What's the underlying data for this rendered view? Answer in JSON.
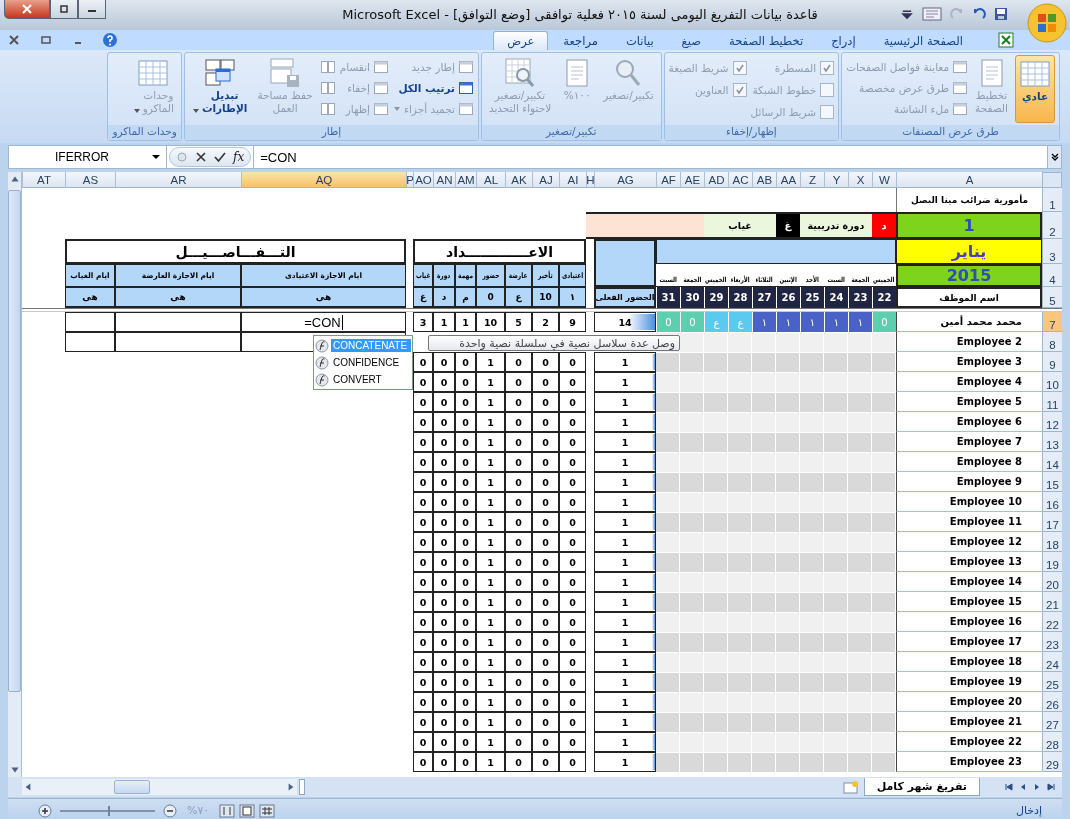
{
  "window": {
    "title": "قاعدة بيانات التفريغ اليومى لسنة ٢٠١٥ فعلية توافقى  [وضع التوافق] - Microsoft Excel"
  },
  "tabs": [
    {
      "label": "الصفحة الرئيسية",
      "selected": false
    },
    {
      "label": "إدراج",
      "selected": false
    },
    {
      "label": "تخطيط الصفحة",
      "selected": false
    },
    {
      "label": "صيغ",
      "selected": false
    },
    {
      "label": "بيانات",
      "selected": false
    },
    {
      "label": "مراجعة",
      "selected": false
    },
    {
      "label": "عرض",
      "selected": true
    }
  ],
  "ribbon": {
    "groups": [
      {
        "label": "طرق عرض المصنفات",
        "columns": [
          [
            {
              "kind": "large",
              "label": "عادي",
              "selected": true,
              "disabled": false
            }
          ],
          [
            {
              "kind": "large",
              "label": "تخطيط\nالصفحة",
              "selected": false,
              "disabled": true
            }
          ],
          [
            {
              "kind": "small",
              "label": "معاينة فواصل الصفحات",
              "disabled": true
            },
            {
              "kind": "small",
              "label": "طرق عرض مخصصة",
              "disabled": true
            },
            {
              "kind": "small",
              "label": "ملء الشاشة",
              "disabled": true
            }
          ]
        ]
      },
      {
        "label": "إظهار/إخفاء",
        "columns": [
          [
            {
              "kind": "check",
              "label": "المسطرة",
              "checked": true,
              "disabled": true
            },
            {
              "kind": "check",
              "label": "خطوط الشبكة",
              "checked": false,
              "disabled": true
            },
            {
              "kind": "check",
              "label": "شريط الرسائل",
              "checked": false,
              "disabled": true
            }
          ],
          [
            {
              "kind": "check",
              "label": "شريط الصيغة",
              "checked": true,
              "disabled": true
            },
            {
              "kind": "check",
              "label": "العناوين",
              "checked": true,
              "disabled": true
            }
          ]
        ]
      },
      {
        "label": "تكبير/تصغير",
        "columns": [
          [
            {
              "kind": "large",
              "label": "تكبير/تصغير",
              "selected": false,
              "disabled": true
            }
          ],
          [
            {
              "kind": "large",
              "label": "١٠٠%",
              "selected": false,
              "disabled": true
            }
          ],
          [
            {
              "kind": "large",
              "label": "تكبير/تصغير\nلاحتواء التحديد",
              "selected": false,
              "disabled": true
            }
          ]
        ]
      },
      {
        "label": "إطار",
        "columns": [
          [
            {
              "kind": "small",
              "label": "إطار جديد",
              "disabled": true
            },
            {
              "kind": "small",
              "label": "ترتيب الكل",
              "disabled": false
            },
            {
              "kind": "small",
              "label": "تجميد أجزاء",
              "disabled": true,
              "caret": true
            }
          ],
          [
            {
              "kind": "small",
              "label": "انقسام",
              "disabled": true
            },
            {
              "kind": "small",
              "label": "إخفاء",
              "disabled": true
            },
            {
              "kind": "small",
              "label": "إظهار",
              "disabled": true
            }
          ],
          [
            {
              "kind": "icon",
              "disabled": true
            },
            {
              "kind": "icon",
              "disabled": true
            },
            {
              "kind": "icon",
              "disabled": true
            }
          ],
          [
            {
              "kind": "large",
              "label": "حفظ مساحة\nالعمل",
              "selected": false,
              "disabled": true
            }
          ],
          [
            {
              "kind": "large",
              "label": "تبديل\nالإطارات",
              "selected": false,
              "disabled": false,
              "caret": true
            }
          ]
        ]
      },
      {
        "label": "وحدات الماكرو",
        "columns": [
          [
            {
              "kind": "large",
              "label": "وحدات\nالماكرو",
              "selected": false,
              "disabled": true,
              "caret": true
            }
          ]
        ]
      }
    ]
  },
  "formula_bar": {
    "name_box": "IFERROR",
    "insert_function": "fx",
    "formula": "=CON"
  },
  "sheet": {
    "columns": [
      {
        "label": "A",
        "selected": false
      },
      {
        "label": "W",
        "selected": false
      },
      {
        "label": "X",
        "selected": false
      },
      {
        "label": "Y",
        "selected": false
      },
      {
        "label": "Z",
        "selected": false
      },
      {
        "label": "AA",
        "selected": false
      },
      {
        "label": "AB",
        "selected": false
      },
      {
        "label": "AC",
        "selected": false
      },
      {
        "label": "AD",
        "selected": false
      },
      {
        "label": "AE",
        "selected": false
      },
      {
        "label": "AF",
        "selected": false
      },
      {
        "label": "AG",
        "selected": false
      },
      {
        "label": "H",
        "selected": false
      },
      {
        "label": "AI",
        "selected": false
      },
      {
        "label": "AJ",
        "selected": false
      },
      {
        "label": "AK",
        "selected": false
      },
      {
        "label": "AL",
        "selected": false
      },
      {
        "label": "AM",
        "selected": false
      },
      {
        "label": "AN",
        "selected": false
      },
      {
        "label": "AO",
        "selected": false
      },
      {
        "label": "P",
        "selected": false
      },
      {
        "label": "AQ",
        "selected": true
      },
      {
        "label": "AR",
        "selected": false
      },
      {
        "label": "AS",
        "selected": false
      },
      {
        "label": "AT",
        "selected": false
      }
    ],
    "top_rows": [
      {
        "num": "1",
        "selected": false
      },
      {
        "num": "2",
        "selected": false
      },
      {
        "num": "3",
        "selected": false
      },
      {
        "num": "4",
        "selected": false
      },
      {
        "num": "5",
        "selected": false
      }
    ],
    "office": "مأمورية ضرائب مينا البصل",
    "number": "1",
    "month": "يناير",
    "year": "2015",
    "name_heading": "اسم الموظف",
    "legend": [
      {
        "code": "د",
        "label": "دورة تدريبية",
        "color": "#ff0000"
      },
      {
        "code": "غ",
        "label": "غياب",
        "color": "#000000"
      }
    ],
    "days": [
      {
        "name": "الخميس",
        "date": "22"
      },
      {
        "name": "الجمعة",
        "date": "23"
      },
      {
        "name": "السبت",
        "date": "24"
      },
      {
        "name": "الأحد",
        "date": "25"
      },
      {
        "name": "الإثنين",
        "date": "26"
      },
      {
        "name": "الثلاثاء",
        "date": "27"
      },
      {
        "name": "الأربعاء",
        "date": "28"
      },
      {
        "name": "الخميس",
        "date": "29"
      },
      {
        "name": "الجمعة",
        "date": "30"
      },
      {
        "name": "السبت",
        "date": "31"
      }
    ],
    "attendance_heading": "الحضور الفعلى",
    "counts": {
      "title": "الاعـــــــــــــداد",
      "columns": [
        {
          "heading": "اعتيادى",
          "code": "١"
        },
        {
          "heading": "تأخير",
          "code": "10"
        },
        {
          "heading": "عارضة",
          "code": "ع"
        },
        {
          "heading": "حضور",
          "code": "0"
        },
        {
          "heading": "مهمة",
          "code": "م"
        },
        {
          "heading": "دورة",
          "code": "د"
        },
        {
          "heading": "غياب",
          "code": "غ"
        }
      ]
    },
    "details": {
      "title": "التـــفـــاصـــيـــل",
      "columns": [
        {
          "heading": "ايام الاجازة الاعتيادى",
          "code": "هى"
        },
        {
          "heading": "ايام الاجازة العارضة",
          "code": "هى"
        },
        {
          "heading": "ايام الغياب",
          "code": "هى"
        }
      ]
    },
    "rows": [
      {
        "num": "7",
        "selected": true,
        "name": "محمد محمد أمين",
        "days": [
          {
            "text": "0",
            "kind": "off"
          },
          {
            "text": "١",
            "kind": "present"
          },
          {
            "text": "١",
            "kind": "present"
          },
          {
            "text": "١",
            "kind": "present"
          },
          {
            "text": "١",
            "kind": "present"
          },
          {
            "text": "١",
            "kind": "present"
          },
          {
            "text": "ع",
            "kind": "leave"
          },
          {
            "text": "ع",
            "kind": "leave"
          },
          {
            "text": "0",
            "kind": "off"
          },
          {
            "text": "0",
            "kind": "off"
          }
        ],
        "attendance": "14",
        "level": 0.45,
        "counts": [
          "9",
          "2",
          "5",
          "10",
          "1",
          "1",
          "3"
        ],
        "detail": true,
        "entry": "=CON"
      },
      {
        "num": "8",
        "selected": false,
        "name": "Employee 2",
        "detail": true
      },
      {
        "num": "9",
        "selected": false,
        "name": "Employee 3",
        "attendance": "1",
        "level": 0.05,
        "counts": [
          "0",
          "0",
          "0",
          "1",
          "0",
          "0",
          "0"
        ]
      },
      {
        "num": "10",
        "selected": false,
        "name": "Employee 4",
        "attendance": "1",
        "level": 0.05,
        "counts": [
          "0",
          "0",
          "0",
          "1",
          "0",
          "0",
          "0"
        ]
      },
      {
        "num": "11",
        "selected": false,
        "name": "Employee 5",
        "attendance": "1",
        "level": 0.05,
        "counts": [
          "0",
          "0",
          "0",
          "1",
          "0",
          "0",
          "0"
        ]
      },
      {
        "num": "12",
        "selected": false,
        "name": "Employee 6",
        "attendance": "1",
        "level": 0.05,
        "counts": [
          "0",
          "0",
          "0",
          "1",
          "0",
          "0",
          "0"
        ]
      },
      {
        "num": "13",
        "selected": false,
        "name": "Employee 7",
        "attendance": "1",
        "level": 0.05,
        "counts": [
          "0",
          "0",
          "0",
          "1",
          "0",
          "0",
          "0"
        ]
      },
      {
        "num": "14",
        "selected": false,
        "name": "Employee 8",
        "attendance": "1",
        "level": 0.05,
        "counts": [
          "0",
          "0",
          "0",
          "1",
          "0",
          "0",
          "0"
        ]
      },
      {
        "num": "15",
        "selected": false,
        "name": "Employee 9",
        "attendance": "1",
        "level": 0.05,
        "counts": [
          "0",
          "0",
          "0",
          "1",
          "0",
          "0",
          "0"
        ]
      },
      {
        "num": "16",
        "selected": false,
        "name": "Employee 10",
        "attendance": "1",
        "level": 0.05,
        "counts": [
          "0",
          "0",
          "0",
          "1",
          "0",
          "0",
          "0"
        ]
      },
      {
        "num": "17",
        "selected": false,
        "name": "Employee 11",
        "attendance": "1",
        "level": 0.05,
        "counts": [
          "0",
          "0",
          "0",
          "1",
          "0",
          "0",
          "0"
        ]
      },
      {
        "num": "18",
        "selected": false,
        "name": "Employee 12",
        "attendance": "1",
        "level": 0.05,
        "counts": [
          "0",
          "0",
          "0",
          "1",
          "0",
          "0",
          "0"
        ]
      },
      {
        "num": "19",
        "selected": false,
        "name": "Employee 13",
        "attendance": "1",
        "level": 0.05,
        "counts": [
          "0",
          "0",
          "0",
          "1",
          "0",
          "0",
          "0"
        ]
      },
      {
        "num": "20",
        "selected": false,
        "name": "Employee 14",
        "attendance": "1",
        "level": 0.05,
        "counts": [
          "0",
          "0",
          "0",
          "1",
          "0",
          "0",
          "0"
        ]
      },
      {
        "num": "21",
        "selected": false,
        "name": "Employee 15",
        "attendance": "1",
        "level": 0.05,
        "counts": [
          "0",
          "0",
          "0",
          "1",
          "0",
          "0",
          "0"
        ]
      },
      {
        "num": "22",
        "selected": false,
        "name": "Employee 16",
        "attendance": "1",
        "level": 0.05,
        "counts": [
          "0",
          "0",
          "0",
          "1",
          "0",
          "0",
          "0"
        ]
      },
      {
        "num": "23",
        "selected": false,
        "name": "Employee 17",
        "attendance": "1",
        "level": 0.05,
        "counts": [
          "0",
          "0",
          "0",
          "1",
          "0",
          "0",
          "0"
        ]
      },
      {
        "num": "24",
        "selected": false,
        "name": "Employee 18",
        "attendance": "1",
        "level": 0.05,
        "counts": [
          "0",
          "0",
          "0",
          "1",
          "0",
          "0",
          "0"
        ]
      },
      {
        "num": "25",
        "selected": false,
        "name": "Employee 19",
        "attendance": "1",
        "level": 0.05,
        "counts": [
          "0",
          "0",
          "0",
          "1",
          "0",
          "0",
          "0"
        ]
      },
      {
        "num": "26",
        "selected": false,
        "name": "Employee 20",
        "attendance": "1",
        "level": 0.05,
        "counts": [
          "0",
          "0",
          "0",
          "1",
          "0",
          "0",
          "0"
        ]
      },
      {
        "num": "27",
        "selected": false,
        "name": "Employee 21",
        "attendance": "1",
        "level": 0.05,
        "counts": [
          "0",
          "0",
          "0",
          "1",
          "0",
          "0",
          "0"
        ]
      },
      {
        "num": "28",
        "selected": false,
        "name": "Employee 22",
        "attendance": "1",
        "level": 0.05,
        "counts": [
          "0",
          "0",
          "0",
          "1",
          "0",
          "0",
          "0"
        ]
      },
      {
        "num": "29",
        "selected": false,
        "name": "Employee 23",
        "attendance": "1",
        "level": 0.05,
        "counts": [
          "0",
          "0",
          "0",
          "1",
          "0",
          "0",
          "0"
        ]
      }
    ]
  },
  "autocomplete": {
    "items": [
      {
        "label": "CONCATENATE",
        "selected": true
      },
      {
        "label": "CONFIDENCE",
        "selected": false
      },
      {
        "label": "CONVERT",
        "selected": false
      }
    ],
    "tooltip": "وصل عدة سلاسل نصية في سلسلة نصية واحدة"
  },
  "sheet_tabs": [
    {
      "label": "تفريغ شهر كامل",
      "selected": true
    }
  ],
  "status_bar": {
    "mode": "إدخال",
    "zoom": "٧٠%",
    "level": 0.5
  }
}
